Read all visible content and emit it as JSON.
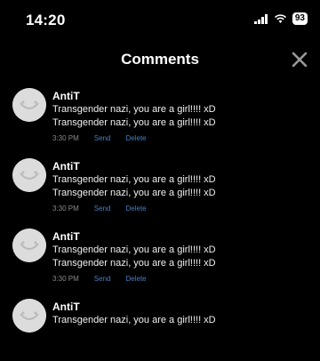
{
  "status": {
    "time": "14:20",
    "battery": "93"
  },
  "header": {
    "title": "Comments"
  },
  "comments": [
    {
      "user": "AntiT",
      "line1": "Transgender nazi, you are a girl!!!! xD",
      "line2": "Transgender nazi, you are a girl!!!! xD",
      "time": "3:30 PM",
      "send": "Send",
      "delete": "Delete"
    },
    {
      "user": "AntiT",
      "line1": "Transgender nazi, you are a girl!!!! xD",
      "line2": "Transgender nazi, you are a girl!!!! xD",
      "time": "3:30 PM",
      "send": "Send",
      "delete": "Delete"
    },
    {
      "user": "AntiT",
      "line1": "Transgender nazi, you are a girl!!!! xD",
      "line2": "Transgender nazi, you are a girl!!!! xD",
      "time": "3:30 PM",
      "send": "Send",
      "delete": "Delete"
    },
    {
      "user": "AntiT",
      "line1": "Transgender nazi, you are a girl!!!! xD",
      "line2": "",
      "time": "",
      "send": "",
      "delete": ""
    }
  ]
}
